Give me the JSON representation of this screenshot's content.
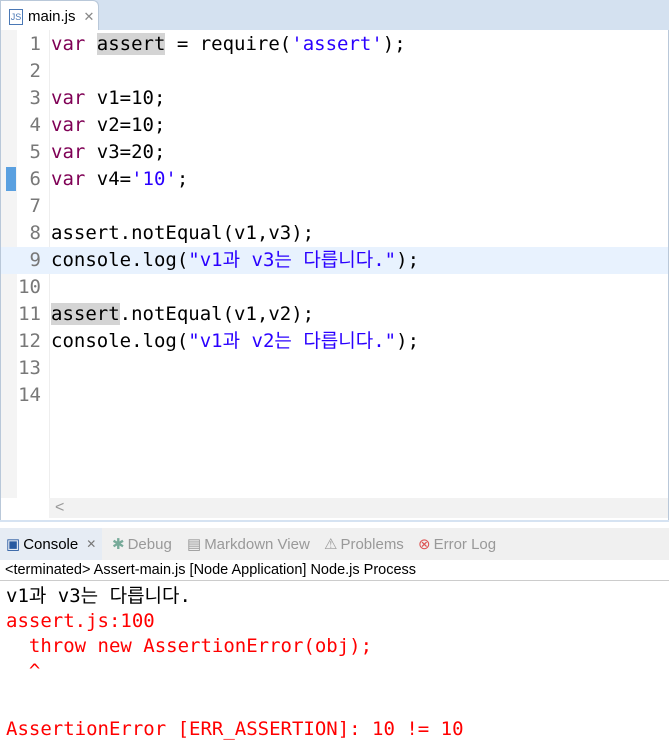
{
  "editor": {
    "tab_label": "main.js",
    "lines": [
      {
        "n": "1"
      },
      {
        "n": "2"
      },
      {
        "n": "3"
      },
      {
        "n": "4"
      },
      {
        "n": "5"
      },
      {
        "n": "6"
      },
      {
        "n": "7"
      },
      {
        "n": "8"
      },
      {
        "n": "9"
      },
      {
        "n": "10"
      },
      {
        "n": "11"
      },
      {
        "n": "12"
      },
      {
        "n": "13"
      },
      {
        "n": "14"
      }
    ],
    "code": {
      "l1a": "var",
      "l1b": "assert",
      "l1c": " = require(",
      "l1d": "'assert'",
      "l1e": ");",
      "l3a": "var",
      "l3b": " v1=10;",
      "l4a": "var",
      "l4b": " v2=10;",
      "l5a": "var",
      "l5b": " v3=20;",
      "l6a": "var",
      "l6b": " v4=",
      "l6c": "'10'",
      "l6d": ";",
      "l8": "assert.notEqual(v1,v3);",
      "l9a": "console.log(",
      "l9b": "\"v1과 v3는 다릅니다.\"",
      "l9c": ");",
      "l11a": "assert",
      "l11b": ".notEqual(v1,v2);",
      "l12a": "console.log(",
      "l12b": "\"v1과 v2는 다릅니다.\"",
      "l12c": ");"
    },
    "scroll_left": "<"
  },
  "console": {
    "tabs": [
      "Console",
      "Debug",
      "Markdown View",
      "Problems",
      "Error Log"
    ],
    "status": "<terminated> Assert-main.js [Node Application] Node.js Process",
    "output": [
      "v1과 v3는 다릅니다.",
      "assert.js:100",
      "  throw new AssertionError(obj);",
      "  ^",
      "",
      "AssertionError [ERR_ASSERTION]: 10 != 10"
    ]
  },
  "colors": {
    "error": "#ff0000",
    "keyword": "#7f0055",
    "string": "#2a00ff"
  }
}
